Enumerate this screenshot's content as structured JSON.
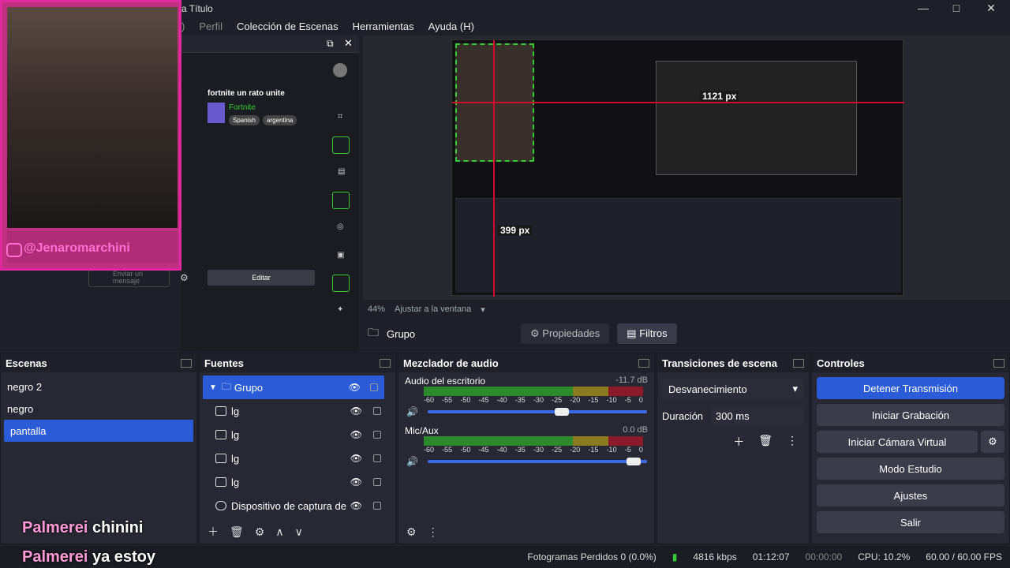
{
  "window": {
    "title": "a Título",
    "min": "—",
    "max": "□",
    "close": "✕"
  },
  "menu": [
    {
      "label": ")"
    },
    {
      "label": "Perfil"
    },
    {
      "label": "Colección de Escenas"
    },
    {
      "label": "Herramientas"
    },
    {
      "label": "Ayuda (H)"
    }
  ],
  "webcam_overlay": {
    "handle": "@Jenaromarchini"
  },
  "chat": {
    "stream_title": "fortnite un rato unite",
    "game": "Fortnite",
    "tags": [
      "Spanish",
      "argentina"
    ],
    "send_placeholder": "Enviar un mensaje",
    "edit_label": "Editar"
  },
  "preview": {
    "measure_top": "1121 px",
    "measure_left": "399 px",
    "zoom": "44%",
    "fit_label": "Ajustar a la ventana"
  },
  "context_bar": {
    "group": "Grupo",
    "properties": "Propiedades",
    "filters": "Filtros"
  },
  "scenes": {
    "title": "Escenas",
    "items": [
      "negro 2",
      "negro",
      "pantalla"
    ],
    "selected": 2
  },
  "sources": {
    "title": "Fuentes",
    "items": [
      "Grupo",
      "lg",
      "lg",
      "lg",
      "lg",
      "Dispositivo de captura de"
    ]
  },
  "mixer": {
    "title": "Mezclador de audio",
    "channels": [
      {
        "name": "Audio del escritorio",
        "db": "-11.7 dB",
        "level": 0.33
      },
      {
        "name": "Mic/Aux",
        "db": "0.0 dB",
        "level": 0.46
      }
    ],
    "ticks": [
      "-60",
      "-55",
      "-50",
      "-45",
      "-40",
      "-35",
      "-30",
      "-25",
      "-20",
      "-15",
      "-10",
      "-5",
      "0"
    ]
  },
  "transitions": {
    "title": "Transiciones de escena",
    "type": "Desvanecimiento",
    "duration_label": "Duración",
    "duration": "300 ms"
  },
  "controls": {
    "title": "Controles",
    "buttons": [
      "Detener Transmisión",
      "Iniciar Grabación",
      "Iniciar Cámara Virtual",
      "Modo Estudio",
      "Ajustes",
      "Salir"
    ]
  },
  "status": {
    "dropped": "Fotogramas Perdidos 0 (0.0%)",
    "bitrate": "4816 kbps",
    "live": "01:12:07",
    "rec": "00:00:00",
    "cpu": "CPU: 10.2%",
    "fps": "60.00 / 60.00 FPS"
  },
  "captions": {
    "line1_name": "Palmerei",
    "line1_text": "chinini",
    "line2_name": "Palmerei",
    "line2_text": "ya estoy"
  },
  "colors": {
    "accent": "#2b5bd6",
    "overlay_pink": "#e0299e",
    "green": "#33cc33",
    "red": "#d10c2a"
  }
}
